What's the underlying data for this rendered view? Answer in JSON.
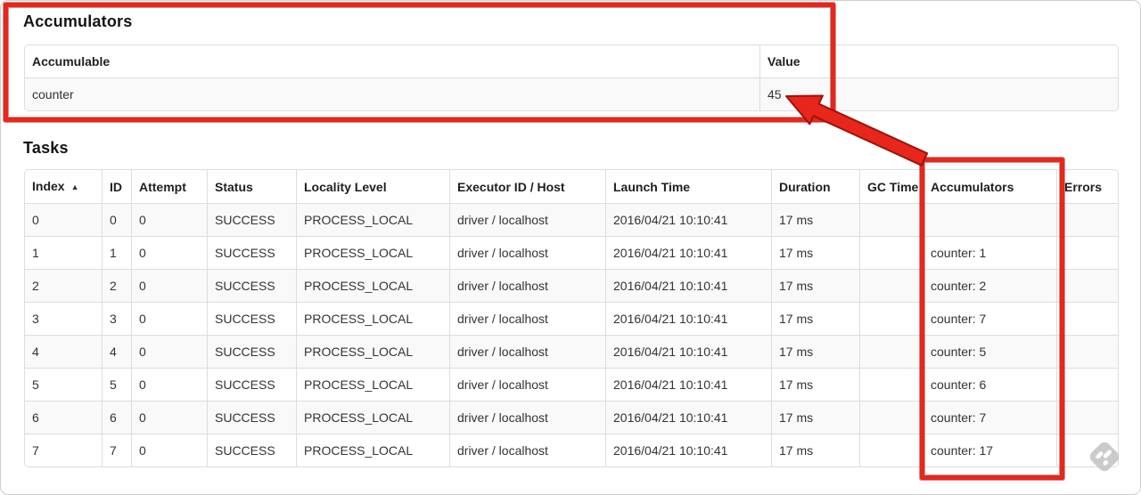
{
  "accumulators_section": {
    "heading": "Accumulators",
    "table": {
      "columns": [
        "Accumulable",
        "Value"
      ],
      "sortable": false,
      "rows": [
        [
          "counter",
          "45"
        ]
      ]
    }
  },
  "tasks_section": {
    "heading": "Tasks",
    "table": {
      "columns": [
        "Index",
        "ID",
        "Attempt",
        "Status",
        "Locality Level",
        "Executor ID / Host",
        "Launch Time",
        "Duration",
        "GC Time",
        "Accumulators",
        "Errors"
      ],
      "sortable": true,
      "sort_column": 0,
      "sort_icon": "▲",
      "rows": [
        [
          "0",
          "0",
          "0",
          "SUCCESS",
          "PROCESS_LOCAL",
          "driver / localhost",
          "2016/04/21 10:10:41",
          "17 ms",
          "",
          "",
          ""
        ],
        [
          "1",
          "1",
          "0",
          "SUCCESS",
          "PROCESS_LOCAL",
          "driver / localhost",
          "2016/04/21 10:10:41",
          "17 ms",
          "",
          "counter: 1",
          ""
        ],
        [
          "2",
          "2",
          "0",
          "SUCCESS",
          "PROCESS_LOCAL",
          "driver / localhost",
          "2016/04/21 10:10:41",
          "17 ms",
          "",
          "counter: 2",
          ""
        ],
        [
          "3",
          "3",
          "0",
          "SUCCESS",
          "PROCESS_LOCAL",
          "driver / localhost",
          "2016/04/21 10:10:41",
          "17 ms",
          "",
          "counter: 7",
          ""
        ],
        [
          "4",
          "4",
          "0",
          "SUCCESS",
          "PROCESS_LOCAL",
          "driver / localhost",
          "2016/04/21 10:10:41",
          "17 ms",
          "",
          "counter: 5",
          ""
        ],
        [
          "5",
          "5",
          "0",
          "SUCCESS",
          "PROCESS_LOCAL",
          "driver / localhost",
          "2016/04/21 10:10:41",
          "17 ms",
          "",
          "counter: 6",
          ""
        ],
        [
          "6",
          "6",
          "0",
          "SUCCESS",
          "PROCESS_LOCAL",
          "driver / localhost",
          "2016/04/21 10:10:41",
          "17 ms",
          "",
          "counter: 7",
          ""
        ],
        [
          "7",
          "7",
          "0",
          "SUCCESS",
          "PROCESS_LOCAL",
          "driver / localhost",
          "2016/04/21 10:10:41",
          "17 ms",
          "",
          "counter: 17",
          ""
        ]
      ]
    }
  },
  "annotations": {
    "highlight_color": "#e8261b",
    "outline_color": "#9a140b"
  },
  "colors": {
    "table_border": "#dddddd",
    "row_stripe": "#f9f9f9",
    "cell_text": "#333333",
    "heading_text": "#141414"
  },
  "watermark": {
    "icon": "feedly-logo"
  }
}
